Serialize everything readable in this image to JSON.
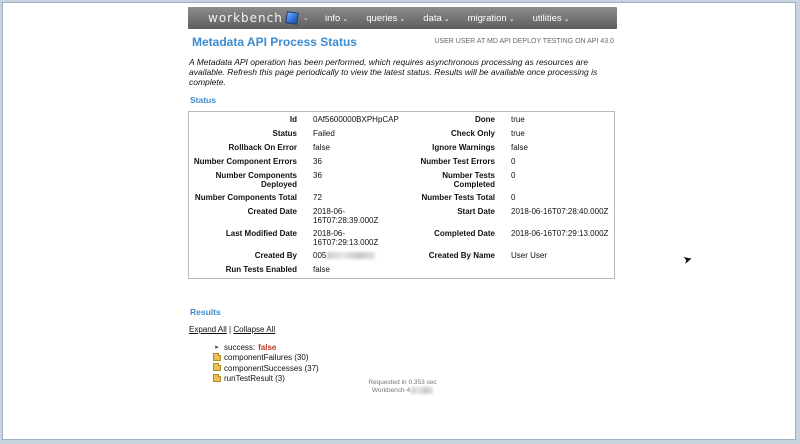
{
  "navbar": {
    "logo": "workbench",
    "menu": [
      {
        "label": "info",
        "caret": "⌄"
      },
      {
        "label": "queries",
        "caret": "⌄"
      },
      {
        "label": "data",
        "caret": "⌄"
      },
      {
        "label": "migration",
        "caret": "⌄"
      },
      {
        "label": "utilities",
        "caret": "⌄"
      }
    ]
  },
  "page": {
    "title": "Metadata API Process Status",
    "user_info": "USER USER AT MD API DEPLOY TESTING ON API 43.0",
    "description": "A Metadata API operation has been performed, which requires asynchronous processing as resources are available. Refresh this page periodically to view the latest status. Results will be available once processing is complete."
  },
  "status": {
    "heading": "Status",
    "rows": [
      {
        "l1": "Id",
        "v1": "0Af5600000BXPHpCAP",
        "l2": "Done",
        "v2": "true"
      },
      {
        "l1": "Status",
        "v1": "Failed",
        "l2": "Check Only",
        "v2": "true"
      },
      {
        "l1": "Rollback On Error",
        "v1": "false",
        "l2": "Ignore Warnings",
        "v2": "false"
      },
      {
        "l1": "Number Component Errors",
        "v1": "36",
        "l2": "Number Test Errors",
        "v2": "0"
      },
      {
        "l1": "Number Components Deployed",
        "v1": "36",
        "l2": "Number Tests Completed",
        "v2": "0"
      },
      {
        "l1": "Number Components Total",
        "v1": "72",
        "l2": "Number Tests Total",
        "v2": "0"
      },
      {
        "l1": "Created Date",
        "v1": "2018-06-16T07:28:39.000Z",
        "l2": "Start Date",
        "v2": "2018-06-16T07:28:40.000Z"
      },
      {
        "l1": "Last Modified Date",
        "v1": "2018-06-16T07:29:13.000Z",
        "l2": "Completed Date",
        "v2": "2018-06-16T07:29:13.000Z"
      },
      {
        "l1": "Created By",
        "v1": "005",
        "l2": "Created By Name",
        "v2": "User User"
      },
      {
        "l1": "Run Tests Enabled",
        "v1": "false",
        "l2": "",
        "v2": ""
      }
    ]
  },
  "results": {
    "heading": "Results",
    "expand_all": "Expand All",
    "separator": "|",
    "collapse_all": "Collapse All",
    "success_label": "success:",
    "success_value": "false",
    "folders": [
      "componentFailures (30)",
      "componentSuccesses (37)",
      "runTestResult (3)"
    ]
  },
  "footer": {
    "requested": "Requested in 0.353 sec",
    "workbench": "Workbench 4"
  },
  "icons": {
    "folder": "folder-icon",
    "expand_arrow": "expand-arrow-icon",
    "logo": "workbench-cube-icon",
    "cursor": "mouse-cursor-icon"
  },
  "colors": {
    "accent": "#3d8cd1",
    "navbar": "#6e6e6e",
    "false_value": "#c0392b"
  }
}
